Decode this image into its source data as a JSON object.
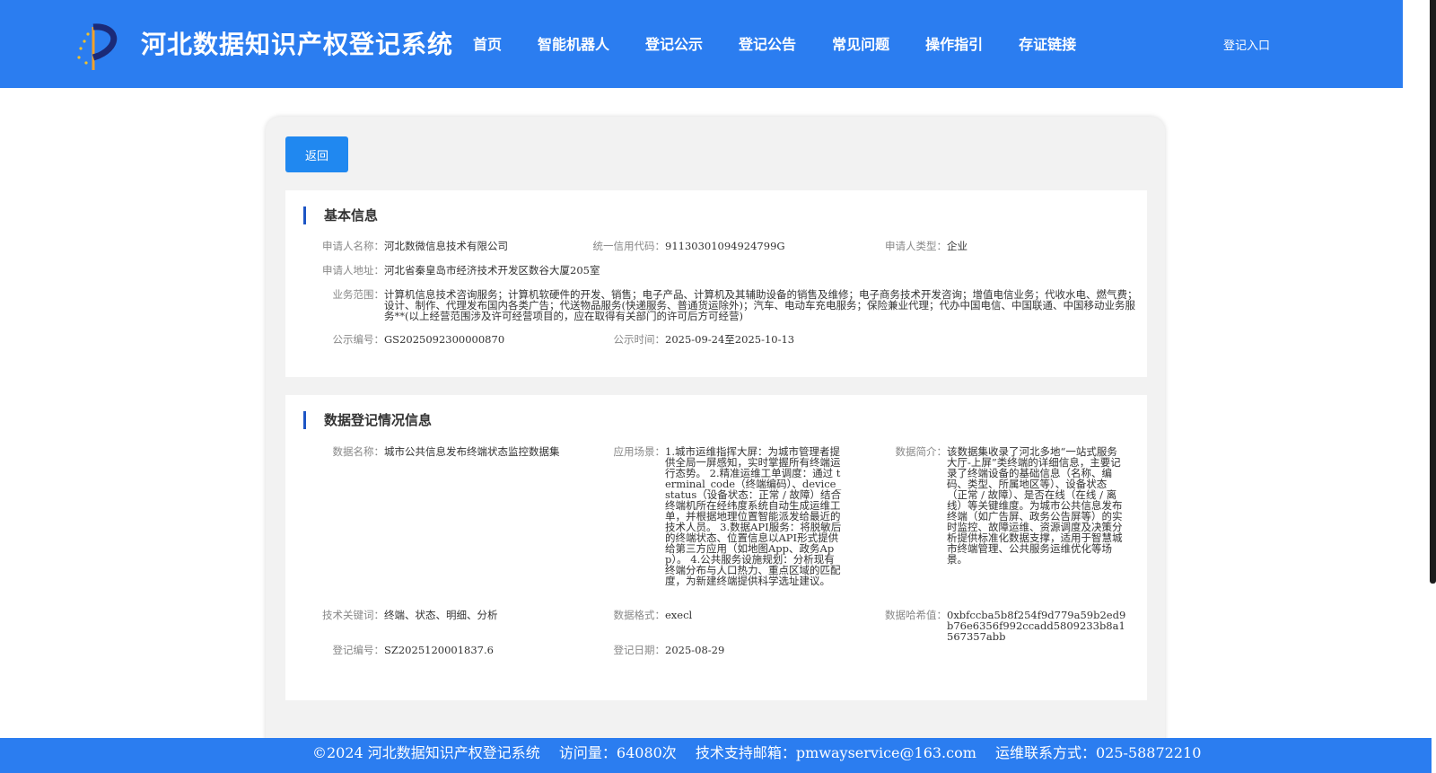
{
  "header": {
    "title": "河北数据知识产权登记系统",
    "nav": [
      "首页",
      "智能机器人",
      "登记公示",
      "登记公告",
      "常见问题",
      "操作指引",
      "存证链接"
    ],
    "login": "登记入口"
  },
  "back_label": "返回",
  "basic": {
    "title": "基本信息",
    "applicant_name_label": "申请人名称：",
    "applicant_name": "河北数微信息技术有限公司",
    "credit_code_label": "统一信用代码：",
    "credit_code": "91130301094924799G",
    "applicant_type_label": "申请人类型：",
    "applicant_type": "企业",
    "address_label": "申请人地址：",
    "address": "河北省秦皇岛市经济技术开发区数谷大厦205室",
    "scope_label": "业务范围：",
    "scope": "计算机信息技术咨询服务；计算机软硬件的开发、销售；电子产品、计算机及其辅助设备的销售及维修；电子商务技术开发咨询；增值电信业务；代收水电、燃气费；设计、制作、代理发布国内各类广告；代送物品服务(快递服务、普通货运除外)；汽车、电动车充电服务；保险兼业代理；代办中国电信、中国联通、中国移动业务服务**(以上经营范围涉及许可经营项目的，应在取得有关部门的许可后方可经营)",
    "notice_no_label": "公示编号：",
    "notice_no": "GS2025092300000870",
    "notice_time_label": "公示时间：",
    "notice_time": "2025-09-24至2025-10-13"
  },
  "data_info": {
    "title": "数据登记情况信息",
    "data_name_label": "数据名称：",
    "data_name": "城市公共信息发布终端状态监控数据集",
    "scenario_label": "应用场景：",
    "scenario": "1.城市运维指挥大屏：为城市管理者提供全局一屏感知，实时掌握所有终端运行态势。 2.精准运维工单调度：通过 terminal_code（终端编码）、device_status（设备状态：正常 / 故障）结合终端机所在经纬度系统自动生成运维工单，并根据地理位置智能派发给最近的技术人员。 3.数据API服务：将脱敏后的终端状态、位置信息以API形式提供给第三方应用（如地图App、政务App）。 4.公共服务设施规划：分析现有终端分布与人口热力、重点区域的匹配度，为新建终端提供科学选址建议。",
    "intro_label": "数据简介：",
    "intro": "该数据集收录了河北多地“一站式服务大厅-上屏”类终端的详细信息，主要记录了终端设备的基础信息（名称、编码、类型、所属地区等）、设备状态（正常 / 故障）、是否在线（在线 / 离线）等关键维度。为城市公共信息发布终端（如广告屏、政务公告屏等）的实时监控、故障运维、资源调度及决策分析提供标准化数据支撑，适用于智慧城市终端管理、公共服务运维优化等场景。",
    "keywords_label": "技术关键词：",
    "keywords": "终端、状态、明细、分析",
    "format_label": "数据格式：",
    "format": "execl",
    "hash_label": "数据哈希值：",
    "hash": "0xbfccba5b8f254f9d779a59b2ed9b76e6356f992ccadd5809233b8a1567357abb",
    "reg_no_label": "登记编号：",
    "reg_no": "SZ20251200018​37.6",
    "reg_date_label": "登记日期：",
    "reg_date": "2025-08-29"
  },
  "footer": {
    "copyright": "©2024 河北数据知识产权登记系统",
    "visits": "访问量：64080次",
    "email": "技术支持邮箱：pmwayservice@163.com",
    "phone": "运维联系方式：025-58872210"
  }
}
